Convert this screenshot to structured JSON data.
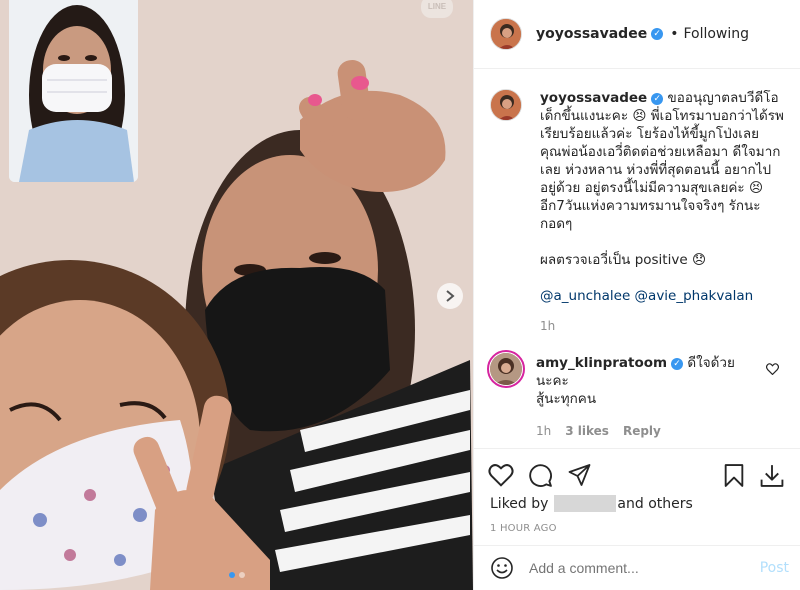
{
  "photo": {
    "watermark": "LINE",
    "carousel": {
      "count": 2,
      "active": 1
    }
  },
  "header": {
    "username": "yoyossavadee",
    "separator": "•",
    "follow_status": "Following"
  },
  "caption": {
    "username": "yoyossavadee",
    "lines": [
      "ขออนุญาตลบวีดีโอ",
      "เด็กขึ้นแงนะคะ 😣 พี่เอโทรมาบอกว่าได้รพ",
      "เรียบร้อยแล้วค่ะ โยร้องไห้ขี้มูกโป่งเลย",
      "คุณพ่อน้องเอวี่ติดต่อช่วยเหลือมา ดีใจมาก",
      "เลย ห่วงหลาน ห่วงพี่ที่สุดตอนนี้ อยากไป",
      "อยู่ด้วย อยู่ตรงนี้ไม่มีความสุขเลยค่ะ 😣",
      "อีก7วันแห่งความทรมานใจจริงๆ รักนะ",
      "กอดๆ"
    ],
    "result_line": "ผลตรวจเอวี่เป็น positive 😞",
    "mentions": [
      "@a_unchalee",
      "@avie_phakvalan"
    ],
    "time": "1h"
  },
  "reply": {
    "username": "amy_klinpratoom",
    "text_line1": "ดีใจด้วยนะคะ",
    "text_line2": "สู้นะทุกคน",
    "time": "1h",
    "likes": "3 likes",
    "reply_label": "Reply"
  },
  "likes": {
    "prefix": "Liked by",
    "suffix": "and others"
  },
  "posted_ago": "1 HOUR AGO",
  "add_comment": {
    "placeholder": "Add a comment...",
    "post_label": "Post"
  },
  "colors": {
    "accent": "#3897f0",
    "post_disabled": "#b2dffc",
    "mention": "#00376b",
    "muted": "#8e8e8e"
  }
}
